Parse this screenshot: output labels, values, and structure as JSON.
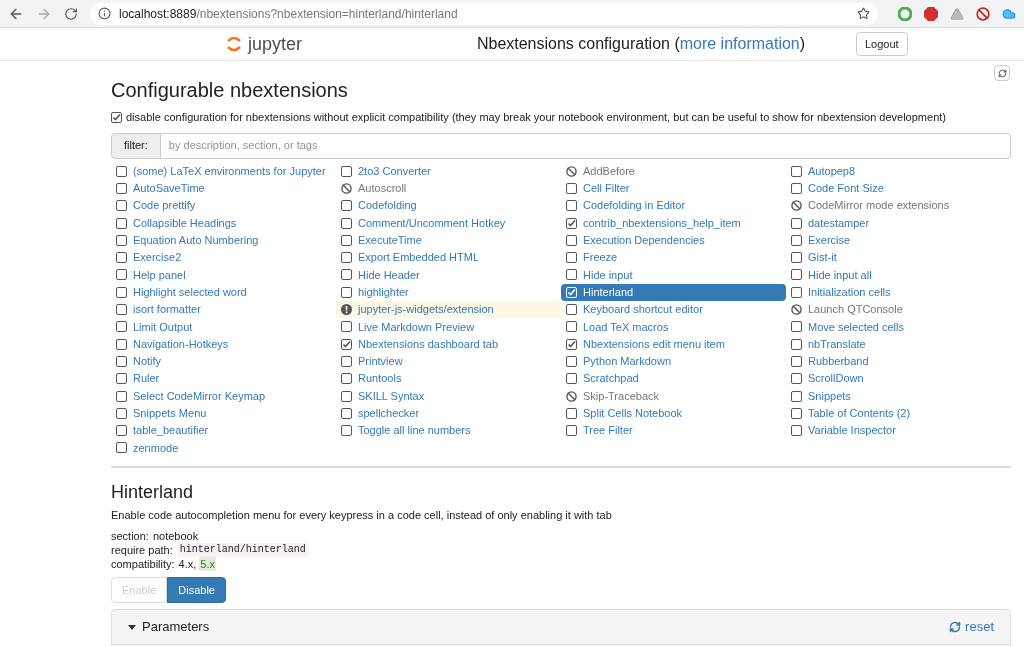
{
  "browser": {
    "url_host": "localhost:8889",
    "url_path": "/nbextensions?nbextension=hinterland/hinterland"
  },
  "header": {
    "logo": "jupyter",
    "title": "Nbextensions configuration (",
    "link": "more information",
    "title_end": ")",
    "logout": "Logout"
  },
  "heading": "Configurable nbextensions",
  "compat_option": {
    "checked": true,
    "label": "disable configuration for nbextensions without explicit compatibility (they may break your notebook environment, but can be useful to show for nbextension development)"
  },
  "filter": {
    "label": "filter:",
    "placeholder": "by description, section, or tags"
  },
  "extensions": [
    {
      "label": "(some) LaTeX environments for Jupyter",
      "kind": "checkbox",
      "checked": false,
      "selected": false
    },
    {
      "label": "2to3 Converter",
      "kind": "checkbox",
      "checked": false,
      "selected": false
    },
    {
      "label": "AddBefore",
      "kind": "incompatible",
      "selected": false
    },
    {
      "label": "Autopep8",
      "kind": "checkbox",
      "checked": false,
      "selected": false
    },
    {
      "label": "AutoSaveTime",
      "kind": "checkbox",
      "checked": false,
      "selected": false
    },
    {
      "label": "Autoscroll",
      "kind": "incompatible",
      "selected": false
    },
    {
      "label": "Cell Filter",
      "kind": "checkbox",
      "checked": false,
      "selected": false
    },
    {
      "label": "Code Font Size",
      "kind": "checkbox",
      "checked": false,
      "selected": false
    },
    {
      "label": "Code prettify",
      "kind": "checkbox",
      "checked": false,
      "selected": false
    },
    {
      "label": "Codefolding",
      "kind": "checkbox",
      "checked": false,
      "selected": false
    },
    {
      "label": "Codefolding in Editor",
      "kind": "checkbox",
      "checked": false,
      "selected": false
    },
    {
      "label": "CodeMirror mode extensions",
      "kind": "incompatible",
      "selected": false
    },
    {
      "label": "Collapsible Headings",
      "kind": "checkbox",
      "checked": false,
      "selected": false
    },
    {
      "label": "Comment/Uncomment Hotkey",
      "kind": "checkbox",
      "checked": false,
      "selected": false
    },
    {
      "label": "contrib_nbextensions_help_item",
      "kind": "checkbox",
      "checked": true,
      "selected": false
    },
    {
      "label": "datestamper",
      "kind": "checkbox",
      "checked": false,
      "selected": false
    },
    {
      "label": "Equation Auto Numbering",
      "kind": "checkbox",
      "checked": false,
      "selected": false
    },
    {
      "label": "ExecuteTime",
      "kind": "checkbox",
      "checked": false,
      "selected": false
    },
    {
      "label": "Execution Dependencies",
      "kind": "checkbox",
      "checked": false,
      "selected": false
    },
    {
      "label": "Exercise",
      "kind": "checkbox",
      "checked": false,
      "selected": false
    },
    {
      "label": "Exercise2",
      "kind": "checkbox",
      "checked": false,
      "selected": false
    },
    {
      "label": "Export Embedded HTML",
      "kind": "checkbox",
      "checked": false,
      "selected": false
    },
    {
      "label": "Freeze",
      "kind": "checkbox",
      "checked": false,
      "selected": false
    },
    {
      "label": "Gist-it",
      "kind": "checkbox",
      "checked": false,
      "selected": false
    },
    {
      "label": "Help panel",
      "kind": "checkbox",
      "checked": false,
      "selected": false
    },
    {
      "label": "Hide Header",
      "kind": "checkbox",
      "checked": false,
      "selected": false
    },
    {
      "label": "Hide input",
      "kind": "checkbox",
      "checked": false,
      "selected": false
    },
    {
      "label": "Hide input all",
      "kind": "checkbox",
      "checked": false,
      "selected": false
    },
    {
      "label": "Highlight selected word",
      "kind": "checkbox",
      "checked": false,
      "selected": false
    },
    {
      "label": "highlighter",
      "kind": "checkbox",
      "checked": false,
      "selected": false
    },
    {
      "label": "Hinterland",
      "kind": "checkbox",
      "checked": true,
      "selected": true
    },
    {
      "label": "Initialization cells",
      "kind": "checkbox",
      "checked": false,
      "selected": false
    },
    {
      "label": "isort formatter",
      "kind": "checkbox",
      "checked": false,
      "selected": false
    },
    {
      "label": "jupyter-js-widgets/extension",
      "kind": "warning",
      "selected": false
    },
    {
      "label": "Keyboard shortcut editor",
      "kind": "checkbox",
      "checked": false,
      "selected": false
    },
    {
      "label": "Launch QTConsole",
      "kind": "incompatible",
      "selected": false
    },
    {
      "label": "Limit Output",
      "kind": "checkbox",
      "checked": false,
      "selected": false
    },
    {
      "label": "Live Markdown Preview",
      "kind": "checkbox",
      "checked": false,
      "selected": false
    },
    {
      "label": "Load TeX macros",
      "kind": "checkbox",
      "checked": false,
      "selected": false
    },
    {
      "label": "Move selected cells",
      "kind": "checkbox",
      "checked": false,
      "selected": false
    },
    {
      "label": "Navigation-Hotkeys",
      "kind": "checkbox",
      "checked": false,
      "selected": false
    },
    {
      "label": "Nbextensions dashboard tab",
      "kind": "checkbox",
      "checked": true,
      "selected": false
    },
    {
      "label": "Nbextensions edit menu item",
      "kind": "checkbox",
      "checked": true,
      "selected": false
    },
    {
      "label": "nbTranslate",
      "kind": "checkbox",
      "checked": false,
      "selected": false
    },
    {
      "label": "Notify",
      "kind": "checkbox",
      "checked": false,
      "selected": false
    },
    {
      "label": "Printview",
      "kind": "checkbox",
      "checked": false,
      "selected": false
    },
    {
      "label": "Python Markdown",
      "kind": "checkbox",
      "checked": false,
      "selected": false
    },
    {
      "label": "Rubberband",
      "kind": "checkbox",
      "checked": false,
      "selected": false
    },
    {
      "label": "Ruler",
      "kind": "checkbox",
      "checked": false,
      "selected": false
    },
    {
      "label": "Runtools",
      "kind": "checkbox",
      "checked": false,
      "selected": false
    },
    {
      "label": "Scratchpad",
      "kind": "checkbox",
      "checked": false,
      "selected": false
    },
    {
      "label": "ScrollDown",
      "kind": "checkbox",
      "checked": false,
      "selected": false
    },
    {
      "label": "Select CodeMirror Keymap",
      "kind": "checkbox",
      "checked": false,
      "selected": false
    },
    {
      "label": "SKILL Syntax",
      "kind": "checkbox",
      "checked": false,
      "selected": false
    },
    {
      "label": "Skip-Traceback",
      "kind": "incompatible",
      "selected": false
    },
    {
      "label": "Snippets",
      "kind": "checkbox",
      "checked": false,
      "selected": false
    },
    {
      "label": "Snippets Menu",
      "kind": "checkbox",
      "checked": false,
      "selected": false
    },
    {
      "label": "spellchecker",
      "kind": "checkbox",
      "checked": false,
      "selected": false
    },
    {
      "label": "Split Cells Notebook",
      "kind": "checkbox",
      "checked": false,
      "selected": false
    },
    {
      "label": "Table of Contents (2)",
      "kind": "checkbox",
      "checked": false,
      "selected": false
    },
    {
      "label": "table_beautifier",
      "kind": "checkbox",
      "checked": false,
      "selected": false
    },
    {
      "label": "Toggle all line numbers",
      "kind": "checkbox",
      "checked": false,
      "selected": false
    },
    {
      "label": "Tree Filter",
      "kind": "checkbox",
      "checked": false,
      "selected": false
    },
    {
      "label": "Variable Inspector",
      "kind": "checkbox",
      "checked": false,
      "selected": false
    },
    {
      "label": "zenmode",
      "kind": "checkbox",
      "checked": false,
      "selected": false
    }
  ],
  "detail": {
    "title": "Hinterland",
    "description": "Enable code autocompletion menu for every keypress in a code cell, instead of only enabling it with tab",
    "section_label": "section:",
    "section": "notebook",
    "require_label": "require path:",
    "require_path": "hinterland/hinterland",
    "compat_label": "compatibility:",
    "compat_separator": ",",
    "compat": [
      {
        "text": "4.x",
        "supported": false
      },
      {
        "text": "5.x",
        "supported": true
      }
    ],
    "buttons": [
      {
        "label": "Enable",
        "enabled": false
      },
      {
        "label": "Disable",
        "enabled": true
      }
    ],
    "parameters": {
      "title": "Parameters",
      "expanded": true,
      "reset": "reset"
    }
  }
}
